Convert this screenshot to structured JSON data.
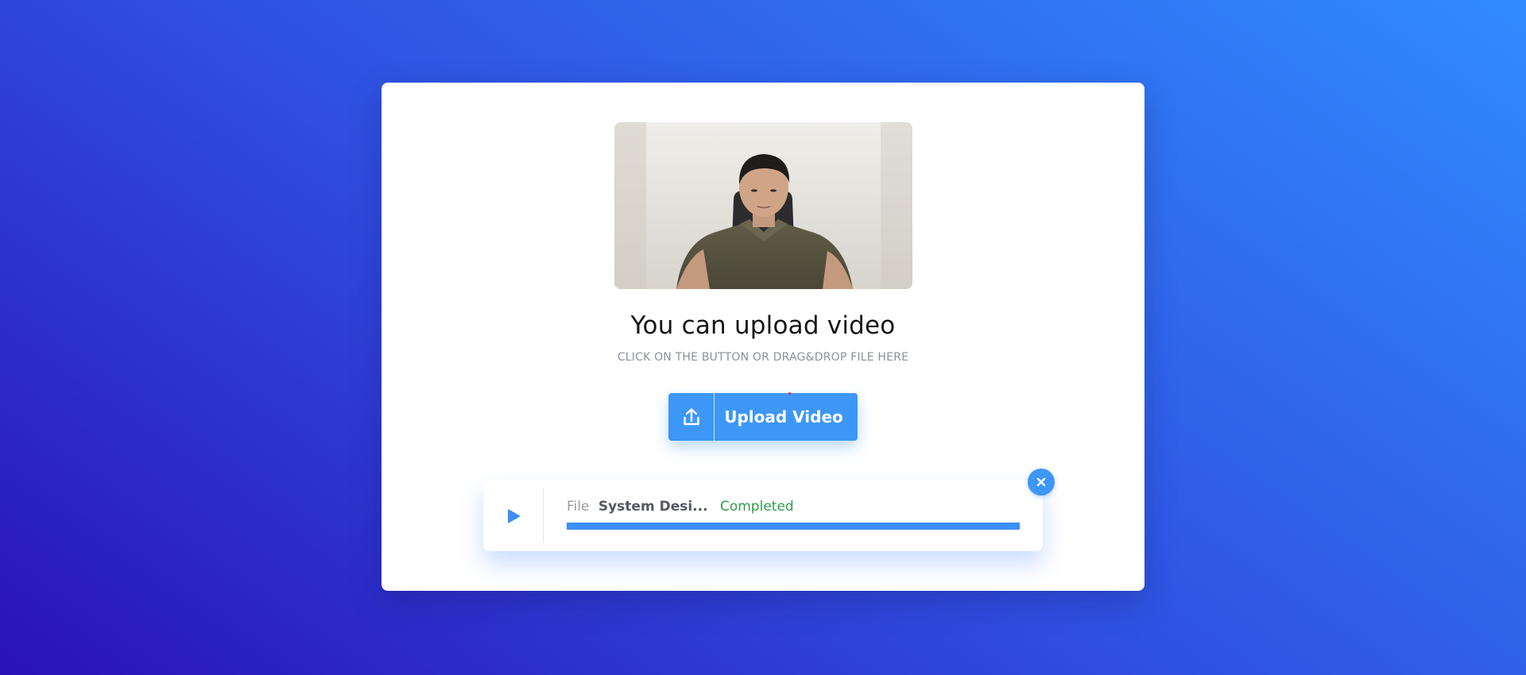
{
  "upload": {
    "title": "You can upload video",
    "subtitle": "CLICK ON THE BUTTON OR DRAG&DROP FILE HERE",
    "button_label": "Upload Video",
    "upload_icon": "upload-icon"
  },
  "file": {
    "label": "File",
    "name": "System Desi...",
    "status": "Completed",
    "progress_percent": 100,
    "play_icon": "play-icon",
    "close_icon": "close-icon"
  },
  "colors": {
    "accent": "#3d97f7",
    "status_completed": "#2f9b4a",
    "progress_fill": "#3c8ff5"
  }
}
